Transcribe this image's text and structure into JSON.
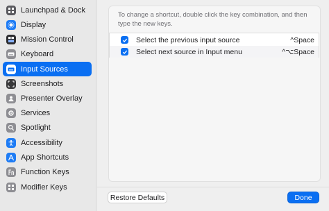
{
  "sidebar": {
    "items": [
      {
        "label": "Launchpad & Dock",
        "icon": "launchpad-icon",
        "color": "#5a5a5f",
        "selected": false
      },
      {
        "label": "Display",
        "icon": "display-icon",
        "color": "#1e7cf5",
        "selected": false
      },
      {
        "label": "Mission Control",
        "icon": "mission-control-icon",
        "color": "#2d2d30",
        "selected": false
      },
      {
        "label": "Keyboard",
        "icon": "keyboard-icon",
        "color": "#8e8e93",
        "selected": false
      },
      {
        "label": "Input Sources",
        "icon": "input-sources-icon",
        "color": "#ffffff",
        "selected": true
      },
      {
        "label": "Screenshots",
        "icon": "screenshots-icon",
        "color": "#3a3a3c",
        "selected": false
      },
      {
        "label": "Presenter Overlay",
        "icon": "presenter-overlay-icon",
        "color": "#8e8e93",
        "selected": false
      },
      {
        "label": "Services",
        "icon": "services-icon",
        "color": "#8e8e93",
        "selected": false
      },
      {
        "label": "Spotlight",
        "icon": "spotlight-icon",
        "color": "#8e8e93",
        "selected": false
      },
      {
        "label": "Accessibility",
        "icon": "accessibility-icon",
        "color": "#1e7cf5",
        "selected": false
      },
      {
        "label": "App Shortcuts",
        "icon": "app-shortcuts-icon",
        "color": "#1e7cf5",
        "selected": false
      },
      {
        "label": "Function Keys",
        "icon": "function-keys-icon",
        "color": "#8e8e93",
        "selected": false
      },
      {
        "label": "Modifier Keys",
        "icon": "modifier-keys-icon",
        "color": "#8e8e93",
        "selected": false
      }
    ]
  },
  "main": {
    "hint": "To change a shortcut, double click the key combination, and then type the new keys.",
    "shortcuts": [
      {
        "label": "Select the previous input source",
        "key": "^Space",
        "checked": true
      },
      {
        "label": "Select next source in Input menu",
        "key": "^⌥Space",
        "checked": true
      }
    ]
  },
  "footer": {
    "restore_label": "Restore Defaults",
    "done_label": "Done"
  },
  "colors": {
    "accent": "#0a6ff2"
  }
}
